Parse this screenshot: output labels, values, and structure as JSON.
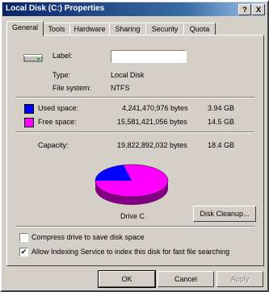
{
  "window": {
    "title": "Local Disk (C:) Properties",
    "help_glyph": "?",
    "close_glyph": "X"
  },
  "tabs": [
    {
      "label": "General",
      "active": true
    },
    {
      "label": "Tools"
    },
    {
      "label": "Hardware"
    },
    {
      "label": "Sharing"
    },
    {
      "label": "Security"
    },
    {
      "label": "Quota"
    }
  ],
  "general": {
    "label_caption": "Label:",
    "label_value": "",
    "type_caption": "Type:",
    "type_value": "Local Disk",
    "fs_caption": "File system:",
    "fs_value": "NTFS",
    "used": {
      "caption": "Used space:",
      "bytes": "4,241,470,976 bytes",
      "size": "3.94 GB",
      "color": "#0000ff"
    },
    "free": {
      "caption": "Free space:",
      "bytes": "15,581,421,056 bytes",
      "size": "14.5 GB",
      "color": "#ff00ff"
    },
    "capacity": {
      "caption": "Capacity:",
      "bytes": "19,822,892,032 bytes",
      "size": "18.4 GB"
    },
    "drive_label": "Drive C",
    "cleanup_button": "Disk Cleanup...",
    "used_fraction": 0.214
  },
  "options": {
    "compress_label": "Compress drive to save disk space",
    "compress_checked": false,
    "index_label": "Allow Indexing Service to index this disk for fast file searching",
    "index_checked": true
  },
  "buttons": {
    "ok": "OK",
    "cancel": "Cancel",
    "apply": "Apply"
  }
}
